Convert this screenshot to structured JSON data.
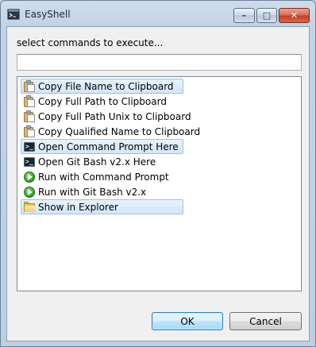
{
  "window": {
    "title": "EasyShell",
    "controls": {
      "minimize": "–",
      "maximize": "□",
      "close": "✕"
    }
  },
  "dialog": {
    "prompt": "select commands to execute...",
    "filter": {
      "value": "",
      "placeholder": ""
    },
    "items": [
      {
        "label": "Copy File Name to Clipboard",
        "icon": "clipboard-icon",
        "selected": true
      },
      {
        "label": "Copy Full Path to Clipboard",
        "icon": "clipboard-icon",
        "selected": false
      },
      {
        "label": "Copy Full Path Unix to Clipboard",
        "icon": "clipboard-icon",
        "selected": false
      },
      {
        "label": "Copy Qualified Name to Clipboard",
        "icon": "clipboard-icon",
        "selected": false
      },
      {
        "label": "Open Command Prompt Here",
        "icon": "terminal-icon",
        "selected": true
      },
      {
        "label": "Open Git Bash v2.x Here",
        "icon": "terminal-icon",
        "selected": false
      },
      {
        "label": "Run with Command Prompt",
        "icon": "run-icon",
        "selected": false
      },
      {
        "label": "Run with Git Bash v2.x",
        "icon": "run-icon",
        "selected": false
      },
      {
        "label": "Show in Explorer",
        "icon": "folder-icon",
        "selected": true
      }
    ],
    "buttons": {
      "ok": "OK",
      "cancel": "Cancel"
    }
  }
}
